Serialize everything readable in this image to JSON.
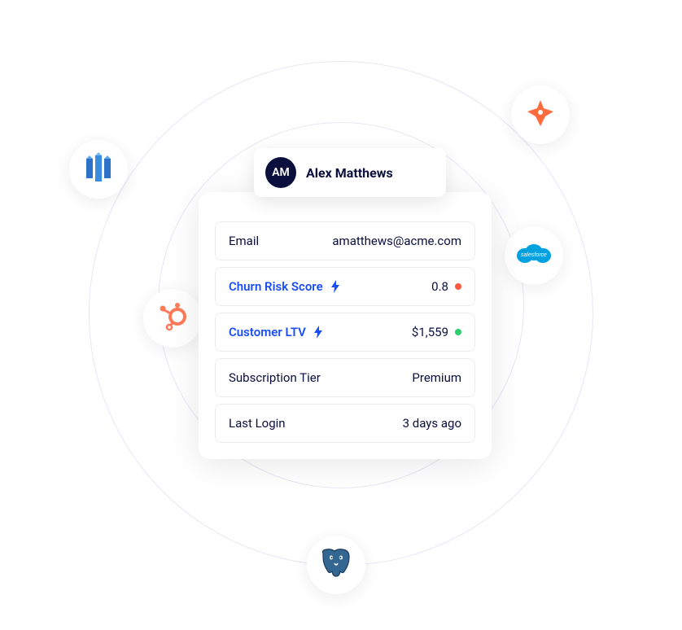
{
  "profile": {
    "initials": "AM",
    "name": "Alex Matthews"
  },
  "attributes": {
    "email": {
      "label": "Email",
      "value": "amatthews@acme.com"
    },
    "churn": {
      "label": "Churn Risk Score",
      "value": "0.8"
    },
    "ltv": {
      "label": "Customer LTV",
      "value": "$1,559"
    },
    "tier": {
      "label": "Subscription Tier",
      "value": "Premium"
    },
    "last_login": {
      "label": "Last Login",
      "value": "3 days ago"
    }
  },
  "integrations": {
    "star": "amplitude-icon",
    "redshift": "redshift-icon",
    "salesforce": "salesforce-icon",
    "hubspot": "hubspot-icon",
    "postgres": "postgres-icon"
  },
  "colors": {
    "accent": "#1a4ef5",
    "danger": "#ff5a3d",
    "good": "#2cce6e"
  }
}
